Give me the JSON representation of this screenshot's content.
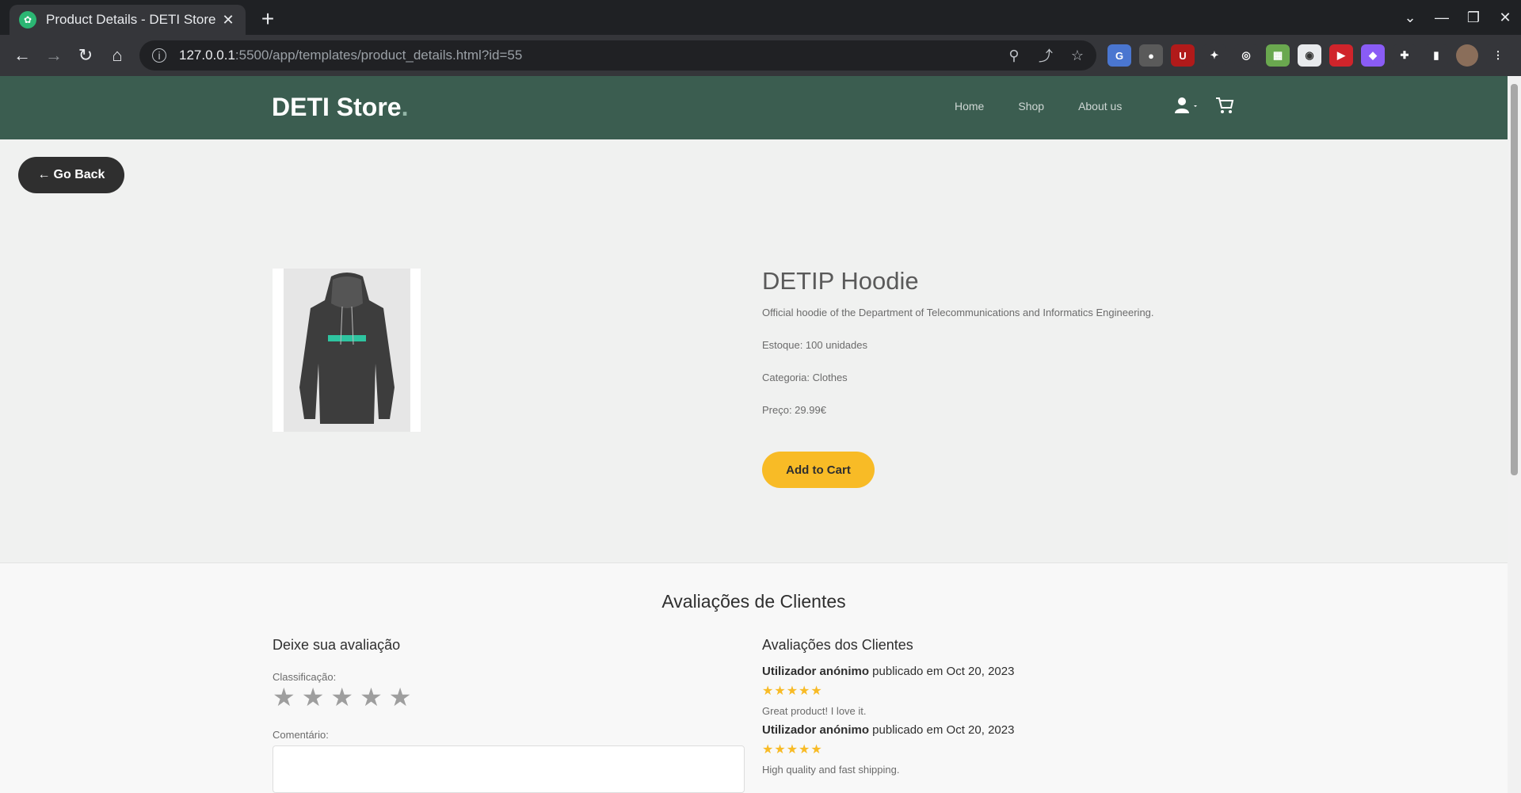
{
  "browser": {
    "tab_title": "Product Details - DETI Store",
    "url_host": "127.0.0.1",
    "url_rest": ":5500/app/templates/product_details.html?id=55"
  },
  "site": {
    "logo": "DETI Store",
    "logo_dot": ".",
    "nav": [
      "Home",
      "Shop",
      "About us"
    ]
  },
  "go_back_label": "Go Back",
  "product": {
    "name": "DETIP Hoodie",
    "description": "Official hoodie of the Department of Telecommunications and Informatics Engineering.",
    "stock": "Estoque: 100 unidades",
    "category": "Categoria: Clothes",
    "price": "Preço: 29.99€",
    "add_to_cart": "Add to Cart"
  },
  "reviews": {
    "title": "Avaliações de Clientes",
    "form_heading": "Deixe sua avaliação",
    "rating_label": "Classificação:",
    "comment_label": "Comentário:",
    "list_heading": "Avaliações dos Clientes",
    "items": [
      {
        "author": "Utilizador anónimo",
        "meta": " publicado em Oct 20, 2023",
        "stars": "★★★★★",
        "text": "Great product! I love it."
      },
      {
        "author": "Utilizador anónimo",
        "meta": " publicado em Oct 20, 2023",
        "stars": "★★★★★",
        "text": "High quality and fast shipping."
      }
    ]
  }
}
